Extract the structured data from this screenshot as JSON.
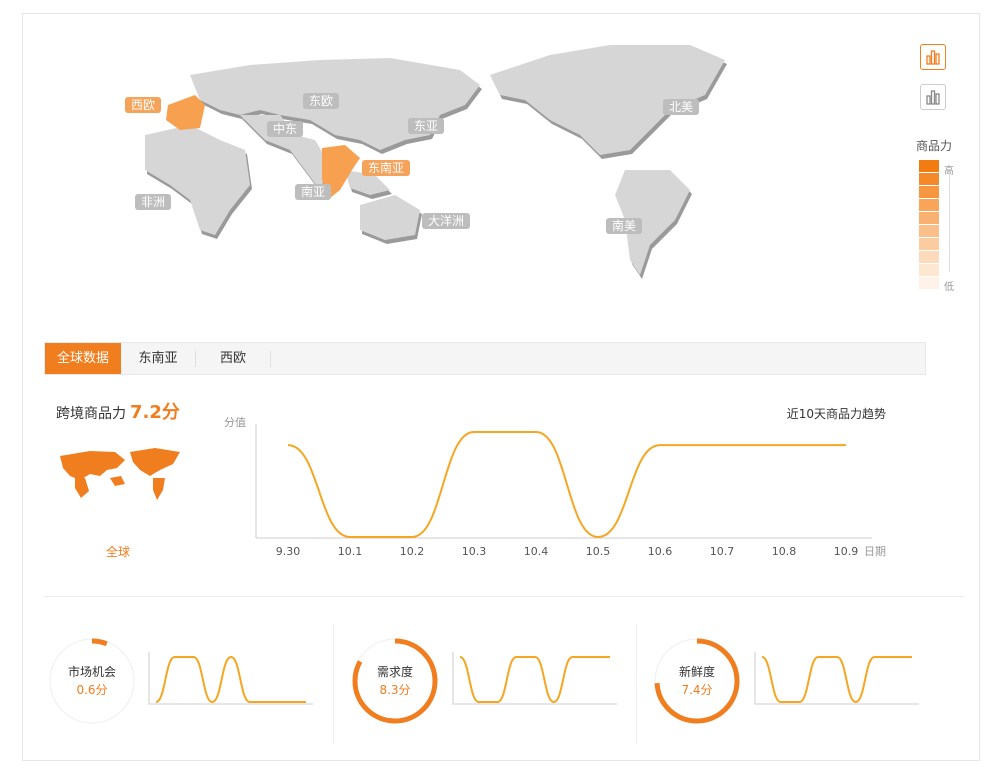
{
  "map": {
    "regions": [
      {
        "name": "西欧",
        "hot": true
      },
      {
        "name": "东欧",
        "hot": false
      },
      {
        "name": "中东",
        "hot": false
      },
      {
        "name": "东亚",
        "hot": false
      },
      {
        "name": "东南亚",
        "hot": true
      },
      {
        "name": "南亚",
        "hot": false
      },
      {
        "name": "非洲",
        "hot": false
      },
      {
        "name": "大洋洲",
        "hot": false
      },
      {
        "name": "北美",
        "hot": false
      },
      {
        "name": "南美",
        "hot": false
      }
    ]
  },
  "side": {
    "legend_title": "商品力",
    "legend_high": "高",
    "legend_low": "低",
    "buttons": [
      {
        "icon": "bar-chart-icon",
        "active": true
      },
      {
        "icon": "bar-chart-outline-icon",
        "active": false
      }
    ]
  },
  "tabs": [
    {
      "label": "全球数据",
      "active": true
    },
    {
      "label": "东南亚",
      "active": false
    },
    {
      "label": "西欧",
      "active": false
    }
  ],
  "score": {
    "label": "跨境商品力",
    "value": "7.2分",
    "region_label": "全球"
  },
  "trend_title": "近10天商品力趋势",
  "chart_data": {
    "type": "line",
    "ylabel": "分值",
    "xlabel": "日期",
    "categories": [
      "9.30",
      "10.1",
      "10.2",
      "10.3",
      "10.4",
      "10.5",
      "10.6",
      "10.7",
      "10.8",
      "10.9"
    ],
    "values": [
      7,
      0,
      0,
      8,
      8,
      0,
      7,
      7,
      7,
      7
    ],
    "ylim": [
      0,
      8
    ],
    "color": "#f5a623"
  },
  "metrics": [
    {
      "label": "市场机会",
      "value": "0.6分",
      "fraction": 0.06,
      "spark": [
        0,
        8,
        8,
        0,
        8,
        0,
        0,
        0,
        0
      ]
    },
    {
      "label": "需求度",
      "value": "8.3分",
      "fraction": 0.83,
      "spark": [
        8,
        0,
        0,
        8,
        8,
        0,
        8,
        8,
        8
      ]
    },
    {
      "label": "新鲜度",
      "value": "7.4分",
      "fraction": 0.74,
      "spark": [
        8,
        0,
        0,
        8,
        8,
        0,
        8,
        8,
        8
      ]
    }
  ],
  "colors": {
    "accent": "#f07d1e",
    "line": "#f5a623",
    "gray": "#cccccc"
  }
}
